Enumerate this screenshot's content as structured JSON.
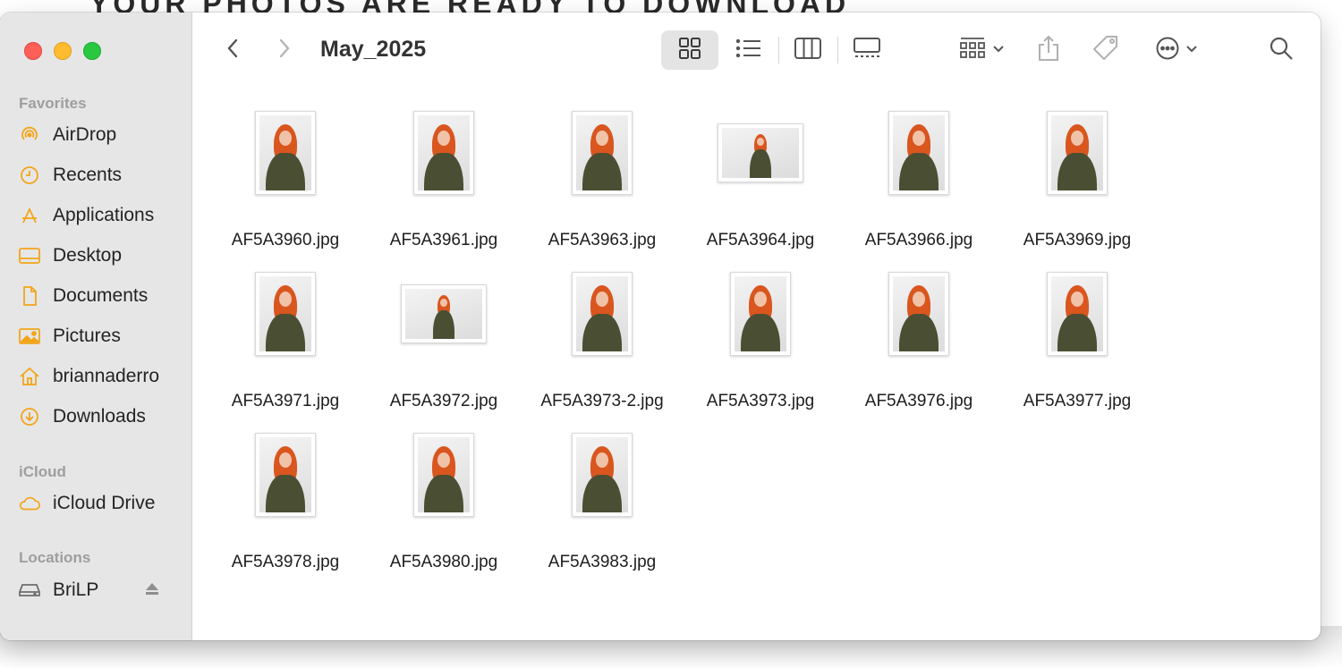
{
  "background_heading": "YOUR PHOTOS ARE READY TO DOWNLOAD",
  "window": {
    "title": "May_2025",
    "toolbar": {
      "back_icon": "chevron-left-icon",
      "forward_icon": "chevron-right-icon",
      "views": [
        "icon-view",
        "list-view",
        "column-view",
        "gallery-view"
      ],
      "active_view": "icon-view"
    }
  },
  "sidebar": {
    "favorites_title": "Favorites",
    "favorites": [
      {
        "label": "AirDrop",
        "icon": "airdrop-icon"
      },
      {
        "label": "Recents",
        "icon": "clock-icon"
      },
      {
        "label": "Applications",
        "icon": "applications-icon"
      },
      {
        "label": "Desktop",
        "icon": "desktop-icon"
      },
      {
        "label": "Documents",
        "icon": "document-icon"
      },
      {
        "label": "Pictures",
        "icon": "pictures-icon"
      },
      {
        "label": "briannaderro",
        "icon": "home-icon"
      },
      {
        "label": "Downloads",
        "icon": "downloads-icon"
      }
    ],
    "icloud_title": "iCloud",
    "icloud": [
      {
        "label": "iCloud Drive",
        "icon": "cloud-icon"
      }
    ],
    "locations_title": "Locations",
    "locations": [
      {
        "label": "BriLP",
        "icon": "drive-icon"
      }
    ]
  },
  "accent_color": "#f5a623",
  "files": [
    {
      "name": "AF5A3960.jpg",
      "orientation": "portrait"
    },
    {
      "name": "AF5A3961.jpg",
      "orientation": "portrait"
    },
    {
      "name": "AF5A3963.jpg",
      "orientation": "portrait"
    },
    {
      "name": "AF5A3964.jpg",
      "orientation": "landscape"
    },
    {
      "name": "AF5A3966.jpg",
      "orientation": "portrait"
    },
    {
      "name": "AF5A3969.jpg",
      "orientation": "portrait"
    },
    {
      "name": "AF5A3971.jpg",
      "orientation": "portrait"
    },
    {
      "name": "AF5A3972.jpg",
      "orientation": "landscape"
    },
    {
      "name": "AF5A3973-2.jpg",
      "orientation": "portrait"
    },
    {
      "name": "AF5A3973.jpg",
      "orientation": "portrait"
    },
    {
      "name": "AF5A3976.jpg",
      "orientation": "portrait"
    },
    {
      "name": "AF5A3977.jpg",
      "orientation": "portrait"
    },
    {
      "name": "AF5A3978.jpg",
      "orientation": "portrait"
    },
    {
      "name": "AF5A3980.jpg",
      "orientation": "portrait"
    },
    {
      "name": "AF5A3983.jpg",
      "orientation": "portrait"
    }
  ]
}
